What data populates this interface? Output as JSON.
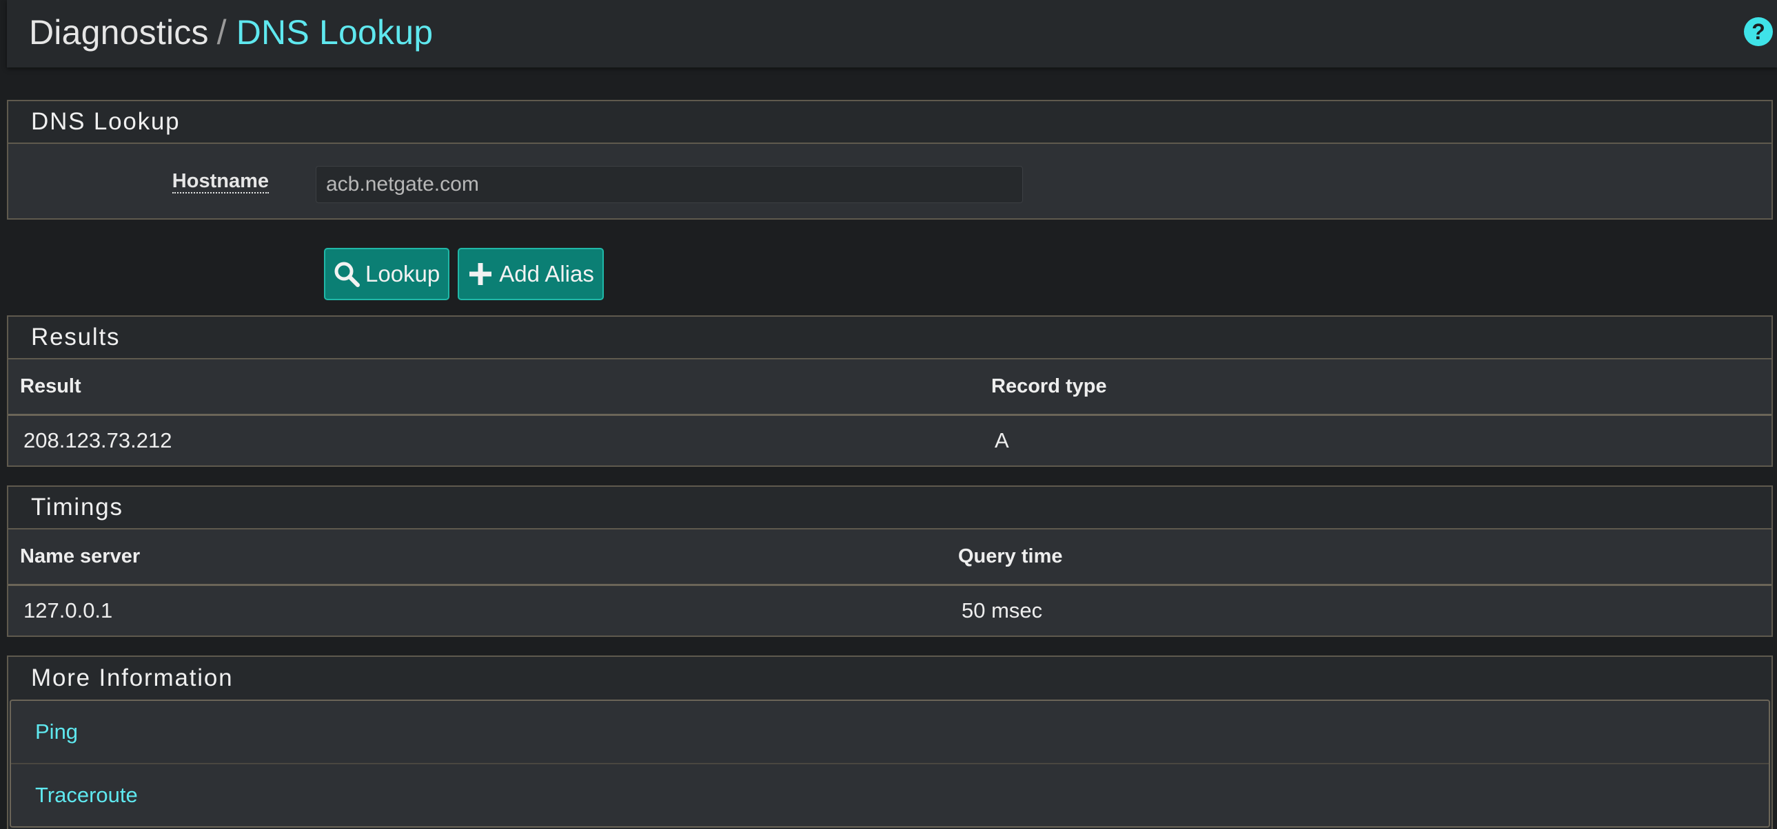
{
  "header": {
    "breadcrumb_parent": "Diagnostics",
    "breadcrumb_separator": "/",
    "breadcrumb_current": "DNS Lookup",
    "help_icon_glyph": "?"
  },
  "lookup_panel": {
    "title": "DNS Lookup",
    "hostname_label": "Hostname",
    "hostname_value": "acb.netgate.com"
  },
  "buttons": {
    "lookup_label": "Lookup",
    "add_alias_label": "Add Alias"
  },
  "results": {
    "title": "Results",
    "columns": [
      "Result",
      "Record type"
    ],
    "rows": [
      [
        "208.123.73.212",
        "A"
      ]
    ]
  },
  "timings": {
    "title": "Timings",
    "columns": [
      "Name server",
      "Query time"
    ],
    "rows": [
      [
        "127.0.0.1",
        "50 msec"
      ]
    ]
  },
  "more_info": {
    "title": "More Information",
    "links": [
      "Ping",
      "Traceroute"
    ]
  },
  "colors": {
    "accent": "#5fe8ef",
    "button": "#0b7f74",
    "background": "#1c1e20",
    "panel": "#2e3135"
  },
  "icons": {
    "help": "help-circle-icon",
    "lookup": "search-icon",
    "add_alias": "plus-icon"
  }
}
